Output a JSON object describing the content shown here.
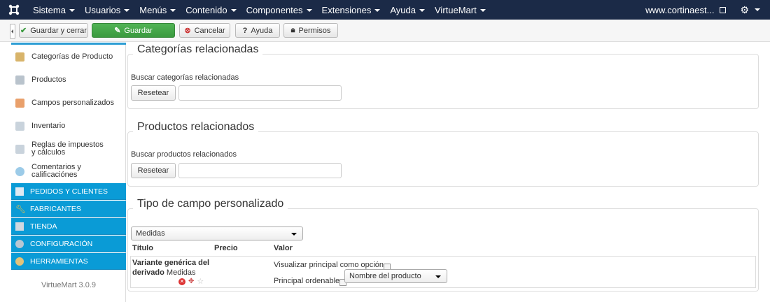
{
  "nav": {
    "items": [
      {
        "label": "Sistema",
        "caret": true
      },
      {
        "label": "Usuarios",
        "caret": true
      },
      {
        "label": "Menús",
        "caret": true
      },
      {
        "label": "Contenido",
        "caret": true
      },
      {
        "label": "Componentes",
        "caret": true
      },
      {
        "label": "Extensiones",
        "caret": true
      },
      {
        "label": "Ayuda",
        "caret": true
      },
      {
        "label": "VirtueMart",
        "caret": true
      }
    ],
    "site": "www.cortinaest...",
    "gear": "⚙"
  },
  "toolbar": {
    "save_close": "Guardar y cerrar",
    "save": "Guardar",
    "cancel": "Cancelar",
    "help": "Ayuda",
    "permissions": "Permisos"
  },
  "sidebar": {
    "items": [
      {
        "label": "Categorías de Producto",
        "icon": "categories-icon"
      },
      {
        "label": "Productos",
        "icon": "products-icon"
      },
      {
        "label": "Campos personalizados",
        "icon": "custom-fields-icon"
      },
      {
        "label": "Inventario",
        "icon": "inventory-icon"
      },
      {
        "label": "Reglas de impuestos y cálculos",
        "icon": "tax-rules-icon"
      },
      {
        "label": "Comentarios y calificaciónes",
        "icon": "comments-icon"
      }
    ],
    "sections": [
      {
        "label": "PEDIDOS Y CLIENTES",
        "icon": "orders-icon"
      },
      {
        "label": "FABRICANTES",
        "icon": "wrench-icon"
      },
      {
        "label": "TIENDA",
        "icon": "shop-icon"
      },
      {
        "label": "CONFIGURACIÓN",
        "icon": "config-icon"
      },
      {
        "label": "HERRAMIENTAS",
        "icon": "tools-icon"
      }
    ],
    "version": "VirtueMart 3.0.9"
  },
  "related_categories": {
    "title": "Categorías relacionadas",
    "search_label": "Buscar categorías relacionadas",
    "reset": "Resetear",
    "value": ""
  },
  "related_products": {
    "title": "Productos relacionados",
    "search_label": "Buscar productos relacionados",
    "reset": "Resetear",
    "value": ""
  },
  "custom_field": {
    "title": "Tipo de campo personalizado",
    "select_value": "Medidas",
    "columns": [
      "Título",
      "Precio",
      "Valor"
    ],
    "row": {
      "title_line1": "Variante genérica del",
      "title_line2": "derivado",
      "title_suffix": "Medidas",
      "option1": "Visualizar principal como opción",
      "option2": "Principal ordenable",
      "option2_select": "Nombre del producto"
    }
  }
}
